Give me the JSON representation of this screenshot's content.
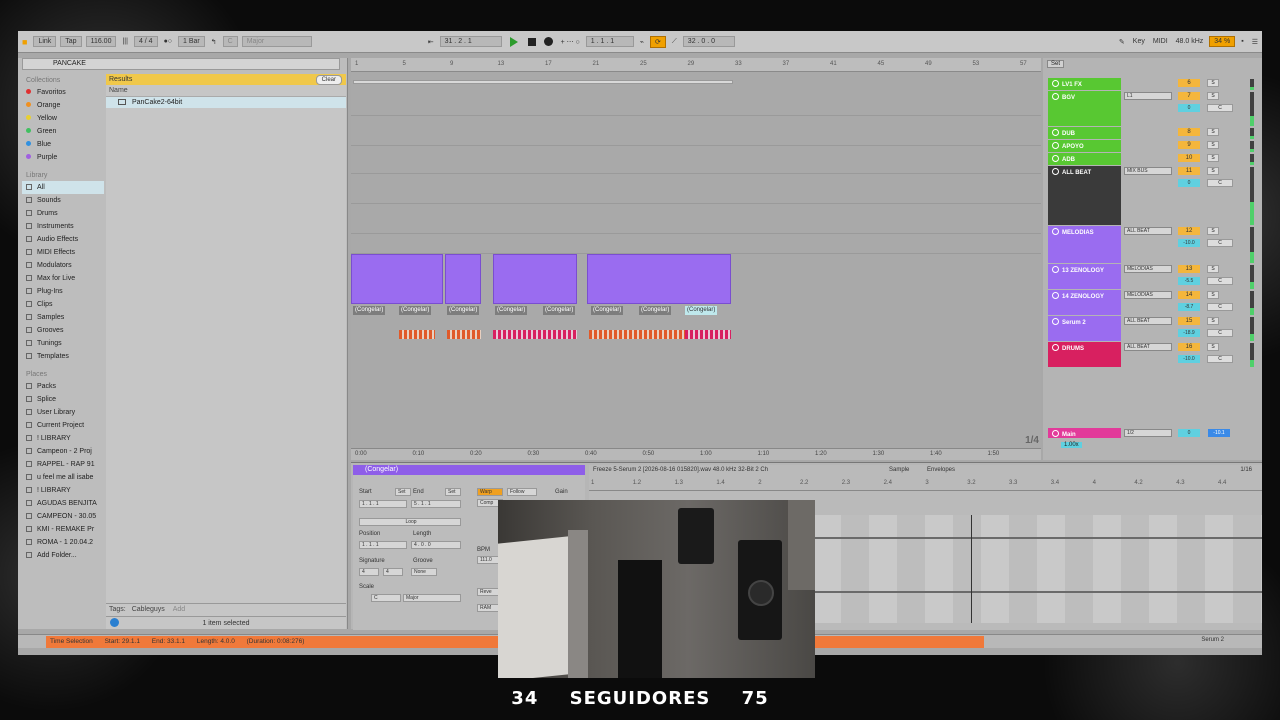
{
  "topbar": {
    "link": "Link",
    "tap": "Tap",
    "tempo": "116.00",
    "time_sig": "4 / 4",
    "quantize": "1 Bar",
    "key_root": "C",
    "key_scale": "Major",
    "position": "31 . 2 . 1",
    "loop_start": "1 . 1 . 1",
    "loop_length": "32 . 0 . 0",
    "key_label": "Key",
    "midi_label": "MIDI",
    "sample_rate": "48.0 kHz",
    "cpu": "34 %"
  },
  "browser": {
    "search_value": "PANCAKE",
    "collections_header": "Collections",
    "collections": [
      {
        "label": "Favoritos",
        "color": "#e03030"
      },
      {
        "label": "Orange",
        "color": "#f09020"
      },
      {
        "label": "Yellow",
        "color": "#e8d030"
      },
      {
        "label": "Green",
        "color": "#40c060"
      },
      {
        "label": "Blue",
        "color": "#3090e0"
      },
      {
        "label": "Purple",
        "color": "#a060e0"
      }
    ],
    "library_header": "Library",
    "library": [
      "All",
      "Sounds",
      "Drums",
      "Instruments",
      "Audio Effects",
      "MIDI Effects",
      "Modulators",
      "Max for Live",
      "Plug-Ins",
      "Clips",
      "Samples",
      "Grooves",
      "Tunings",
      "Templates"
    ],
    "places_header": "Places",
    "places": [
      "Packs",
      "Splice",
      "User Library",
      "Current Project",
      "! LIBRARY",
      "Campeon - 2 Proj",
      "RAPPEL - RAP 91",
      "u feel me all isabe",
      "! LIBRARY",
      "AGUDAS BENJITA",
      "CAMPEON - 30.05",
      "KMI - REMAKE Pr",
      "ROMA - 1 20.04.2",
      "Add Folder..."
    ],
    "results_label": "Results",
    "clear_label": "Clear",
    "name_col": "Name",
    "result_item": "PanCake2-64bit",
    "tags_label": "Tags:",
    "tags_value": "Cableguys",
    "tags_add": "Add",
    "selected_status": "1 item selected"
  },
  "arrangement": {
    "ruler_ticks": [
      "1",
      "5",
      "9",
      "13",
      "17",
      "21",
      "25",
      "29",
      "33",
      "37",
      "41",
      "45",
      "49",
      "53",
      "57"
    ],
    "time_labels": [
      "0:00",
      "0:10",
      "0:20",
      "0:30",
      "0:40",
      "0:50",
      "1:00",
      "1:10",
      "1:20",
      "1:30",
      "1:40",
      "1:50"
    ],
    "clip_label": "(Congelar)",
    "zoom_fraction": "1/4"
  },
  "mixer": {
    "set_label": "Set",
    "tracks": [
      {
        "name": "LV1 FX",
        "color": "#58c832",
        "route": "",
        "num": "6",
        "vol": ""
      },
      {
        "name": "BGV",
        "color": "#58c832",
        "route": "L1",
        "num": "7",
        "vol": "0"
      },
      {
        "name": "DUB",
        "color": "#58c832",
        "route": "",
        "num": "8",
        "vol": ""
      },
      {
        "name": "APOYO",
        "color": "#58c832",
        "route": "",
        "num": "9",
        "vol": ""
      },
      {
        "name": "ADB",
        "color": "#58c832",
        "route": "",
        "num": "10",
        "vol": ""
      },
      {
        "name": "ALL BEAT",
        "color": "#3a3a3a",
        "route": "MIX BUS",
        "num": "11",
        "vol": "0"
      },
      {
        "name": "MELODIAS",
        "color": "#9a6cf0",
        "route": "ALL BEAT",
        "num": "12",
        "vol": "-10.0"
      },
      {
        "name": "13 ZENOLOGY",
        "color": "#9a6cf0",
        "route": "MELODIAS",
        "num": "13",
        "vol": "-5.5"
      },
      {
        "name": "14 ZENOLOGY",
        "color": "#9a6cf0",
        "route": "MELODIAS",
        "num": "14",
        "vol": "-8.7"
      },
      {
        "name": "Serum 2",
        "color": "#9a6cf0",
        "route": "ALL BEAT",
        "num": "15",
        "vol": "-18.9"
      },
      {
        "name": "DRUMS",
        "color": "#d82060",
        "route": "ALL BEAT",
        "num": "16",
        "vol": "-10.0"
      }
    ],
    "main_name": "Main",
    "main_route": "1/2",
    "main_vol": "0",
    "main_vol2": "-10.1",
    "main_zoom": "1.00x",
    "solo_label": "S",
    "c_label": "C"
  },
  "detail": {
    "clip_name": "(Congelar)",
    "start_label": "Start",
    "end_label": "End",
    "set_label": "Set",
    "start_value": "1 . 1 . 1",
    "end_value": "5 . 1 . 1",
    "loop_label": "Loop",
    "position_label": "Position",
    "length_label": "Length",
    "position_value": "1 . 1 . 1",
    "length_value": "4 . 0 . 0",
    "signature_label": "Signature",
    "groove_label": "Groove",
    "sig_num": "4",
    "sig_den": "4",
    "groove_value": "None",
    "scale_label": "Scale",
    "scale_root": "C",
    "scale_mode": "Major",
    "warp_label": "Warp",
    "follow_label": "Follow",
    "gain_label": "Gain",
    "warp_mode": "Comp",
    "bpm_label": "BPM",
    "bpm_value": "111.0",
    "rev_label": "Reve",
    "ram_label": "RAM",
    "file_info": "Freeze 5-Serum 2 [2026-08-16 015820].wav 48.0 kHz 32-Bit 2 Ch",
    "sample_tab": "Sample",
    "envelopes_tab": "Envelopes",
    "grid_frac": "1/16",
    "sample_ruler": [
      "1",
      "1.2",
      "1.3",
      "1.4",
      "2",
      "2.2",
      "2.3",
      "2.4",
      "3",
      "3.2",
      "3.3",
      "3.4",
      "4",
      "4.2",
      "4.3",
      "4.4"
    ]
  },
  "status": {
    "time_selection": "Time Selection",
    "start": "Start: 29.1.1",
    "end": "End: 33.1.1",
    "length": "Length: 4.0.0",
    "duration": "(Duration: 0:08:276)",
    "right_track": "Serum 2"
  },
  "overlay": {
    "followers_left": "34",
    "followers_label": "SEGUIDORES",
    "followers_right": "75"
  }
}
